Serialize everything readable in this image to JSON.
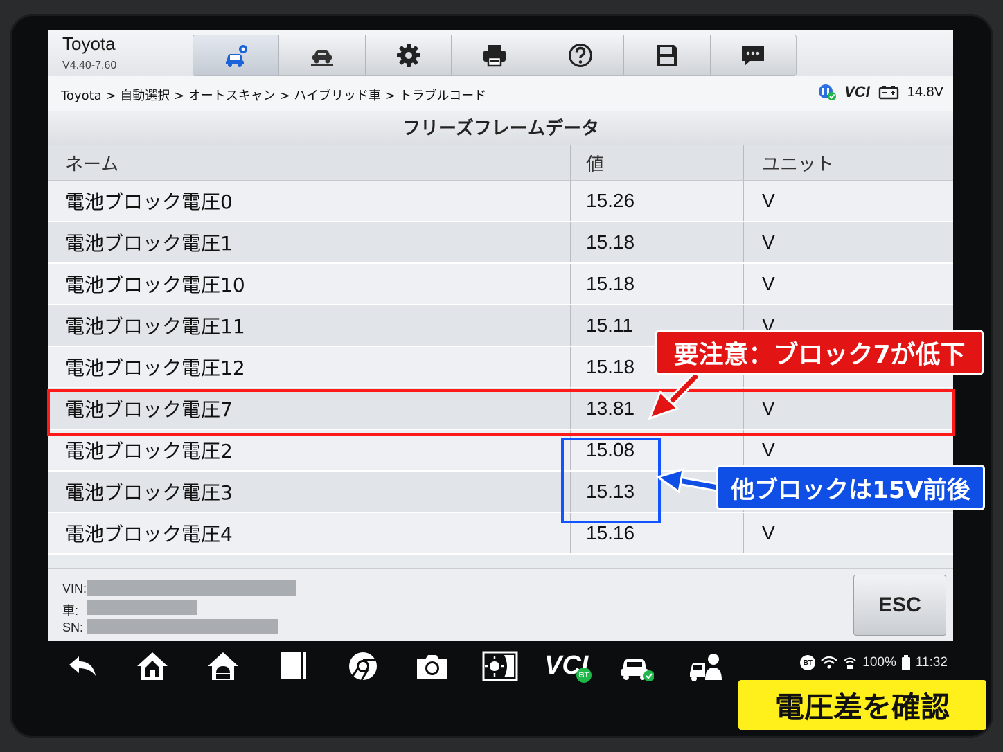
{
  "header": {
    "brand": "Toyota",
    "version": "V4.40-7.60"
  },
  "toolbar": {
    "items": [
      {
        "icon": "car-diagnose-icon",
        "active": true
      },
      {
        "icon": "car-lift-icon"
      },
      {
        "icon": "gear-icon"
      },
      {
        "icon": "printer-icon"
      },
      {
        "icon": "help-icon"
      },
      {
        "icon": "save-icon"
      },
      {
        "icon": "message-icon"
      }
    ]
  },
  "breadcrumb": {
    "text": "Toyota > 自動選択 > オートスキャン > ハイブリッド車 > トラブルコード"
  },
  "status": {
    "vci_label": "VCI",
    "voltage": "14.8V"
  },
  "page_title": "フリーズフレームデータ",
  "table": {
    "headers": {
      "name": "ネーム",
      "value": "値",
      "unit": "ユニット"
    },
    "rows": [
      {
        "name": "電池ブロック電圧0",
        "value": "15.26",
        "unit": "V"
      },
      {
        "name": "電池ブロック電圧1",
        "value": "15.18",
        "unit": "V"
      },
      {
        "name": "電池ブロック電圧10",
        "value": "15.18",
        "unit": "V"
      },
      {
        "name": "電池ブロック電圧11",
        "value": "15.11",
        "unit": "V"
      },
      {
        "name": "電池ブロック電圧12",
        "value": "15.18",
        "unit": "V"
      },
      {
        "name": "電池ブロック電圧7",
        "value": "13.81",
        "unit": "V"
      },
      {
        "name": "電池ブロック電圧2",
        "value": "15.08",
        "unit": "V"
      },
      {
        "name": "電池ブロック電圧3",
        "value": "15.13",
        "unit": "V"
      },
      {
        "name": "電池ブロック電圧4",
        "value": "15.16",
        "unit": "V"
      }
    ]
  },
  "footer": {
    "vin_label": "VIN:",
    "car_label": "車:",
    "sn_label": "SN:",
    "esc_label": "ESC"
  },
  "navbar": {
    "vci_label": "VCI",
    "bt_badge": "BT",
    "bt_status": "BT",
    "battery": "100%",
    "time": "11:32"
  },
  "annotations": {
    "warning": "要注意：ブロック7が低下",
    "info": "他ブロックは15V前後",
    "caption": "電圧差を確認"
  },
  "colors": {
    "warning_red": "#e31414",
    "info_blue": "#0f4fe6",
    "caption_yellow": "#ffef1a"
  }
}
